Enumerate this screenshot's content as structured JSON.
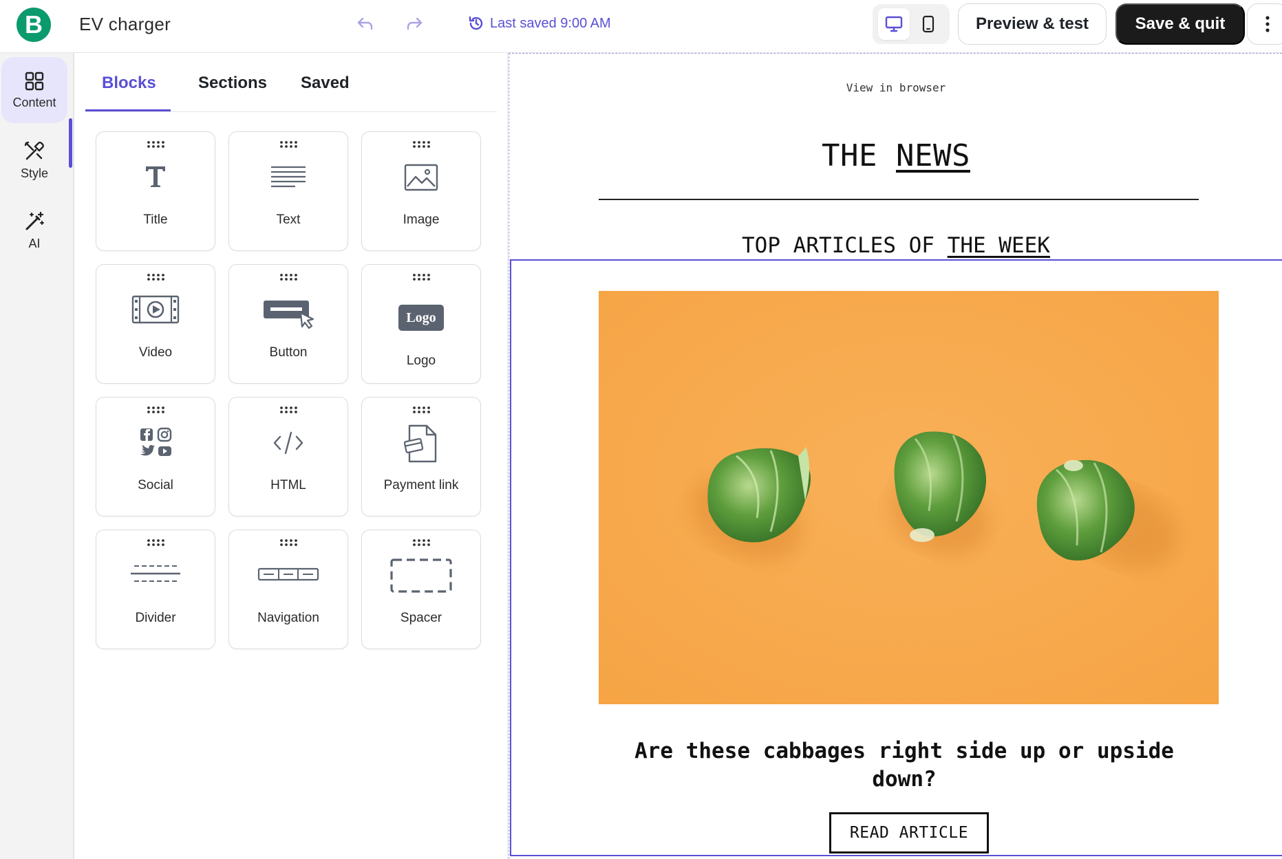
{
  "app": {
    "logo_letter": "B",
    "document_title": "EV charger"
  },
  "toolbar": {
    "last_saved": "Last saved 9:00 AM",
    "preview_label": "Preview & test",
    "save_label": "Save & quit"
  },
  "rail": {
    "items": [
      {
        "label": "Content",
        "icon": "grid-icon",
        "active": true
      },
      {
        "label": "Style",
        "icon": "brush-icon",
        "active": false
      },
      {
        "label": "AI",
        "icon": "magic-wand-icon",
        "active": false
      }
    ]
  },
  "panel": {
    "tabs": [
      {
        "label": "Blocks",
        "active": true
      },
      {
        "label": "Sections",
        "active": false
      },
      {
        "label": "Saved",
        "active": false
      }
    ],
    "blocks": [
      {
        "label": "Title",
        "icon": "title-icon"
      },
      {
        "label": "Text",
        "icon": "text-icon"
      },
      {
        "label": "Image",
        "icon": "image-icon"
      },
      {
        "label": "Video",
        "icon": "video-icon"
      },
      {
        "label": "Button",
        "icon": "button-icon"
      },
      {
        "label": "Logo",
        "icon": "logo-icon",
        "icon_text": "Logo"
      },
      {
        "label": "Social",
        "icon": "social-icon"
      },
      {
        "label": "HTML",
        "icon": "html-icon"
      },
      {
        "label": "Payment link",
        "icon": "payment-link-icon"
      },
      {
        "label": "Divider",
        "icon": "divider-icon"
      },
      {
        "label": "Navigation",
        "icon": "navigation-icon"
      },
      {
        "label": "Spacer",
        "icon": "spacer-icon"
      }
    ]
  },
  "email": {
    "view_in_browser": "View in browser",
    "title_plain": "THE",
    "title_link": "NEWS",
    "section_plain": "TOP ARTICLES OF",
    "section_link": "THE WEEK",
    "article": {
      "headline": "Are these cabbages right side up or upside down?",
      "button_label": "READ ARTICLE"
    }
  },
  "colors": {
    "accent": "#5a4fd6",
    "brand": "#0b9a6d",
    "image_background": "#f7a94d"
  }
}
